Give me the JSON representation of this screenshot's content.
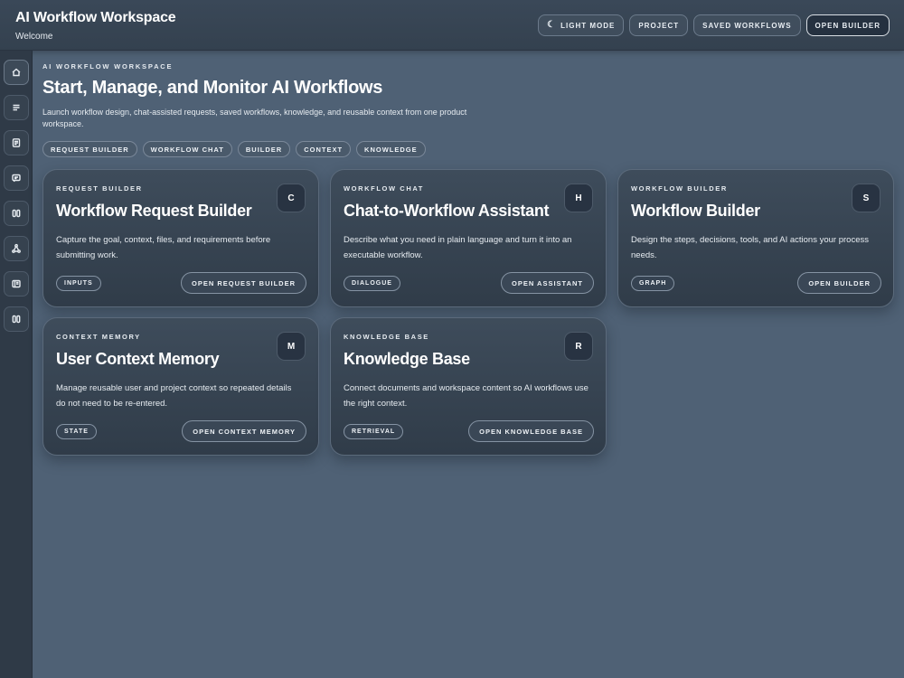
{
  "header": {
    "title": "AI Workflow Workspace",
    "subtitle": "Welcome",
    "actions": [
      {
        "label": "Light Mode",
        "icon": "moon-icon"
      },
      {
        "label": "Project"
      },
      {
        "label": "Saved Workflows"
      },
      {
        "label": "Open Builder"
      }
    ]
  },
  "rail": {
    "items": [
      {
        "icon": "home-icon"
      },
      {
        "icon": "menu-lines-icon"
      },
      {
        "icon": "document-icon"
      },
      {
        "icon": "chat-icon"
      },
      {
        "icon": "columns-icon"
      },
      {
        "icon": "graph-nodes-icon"
      },
      {
        "icon": "book-icon"
      },
      {
        "icon": "columns-icon"
      }
    ]
  },
  "main": {
    "eyebrow": "AI WORKFLOW WORKSPACE",
    "title": "Start, Manage, and Monitor AI Workflows",
    "description": "Launch workflow design, chat-assisted requests, saved workflows, knowledge, and reusable context from one product workspace.",
    "chips": [
      "Request Builder",
      "Workflow Chat",
      "Builder",
      "Context",
      "Knowledge"
    ]
  },
  "cards": [
    {
      "eyebrow": "REQUEST BUILDER",
      "badge": "C",
      "title": "Workflow Request Builder",
      "description": "Capture the goal, context, files, and requirements before submitting work.",
      "tag": "Inputs",
      "button": "Open Request Builder"
    },
    {
      "eyebrow": "WORKFLOW CHAT",
      "badge": "H",
      "title": "Chat-to-Workflow Assistant",
      "description": "Describe what you need in plain language and turn it into an executable workflow.",
      "tag": "Dialogue",
      "button": "Open Assistant"
    },
    {
      "eyebrow": "WORKFLOW BUILDER",
      "badge": "S",
      "title": "Workflow Builder",
      "description": "Design the steps, decisions, tools, and AI actions your process needs.",
      "tag": "Graph",
      "button": "Open Builder"
    },
    {
      "eyebrow": "CONTEXT MEMORY",
      "badge": "M",
      "title": "User Context Memory",
      "description": "Manage reusable user and project context so repeated details do not need to be re-entered.",
      "tag": "State",
      "button": "Open Context Memory"
    },
    {
      "eyebrow": "KNOWLEDGE BASE",
      "badge": "R",
      "title": "Knowledge Base",
      "description": "Connect documents and workspace content so AI workflows use the right context.",
      "tag": "Retrieval",
      "button": "Open Knowledge Base"
    }
  ]
}
